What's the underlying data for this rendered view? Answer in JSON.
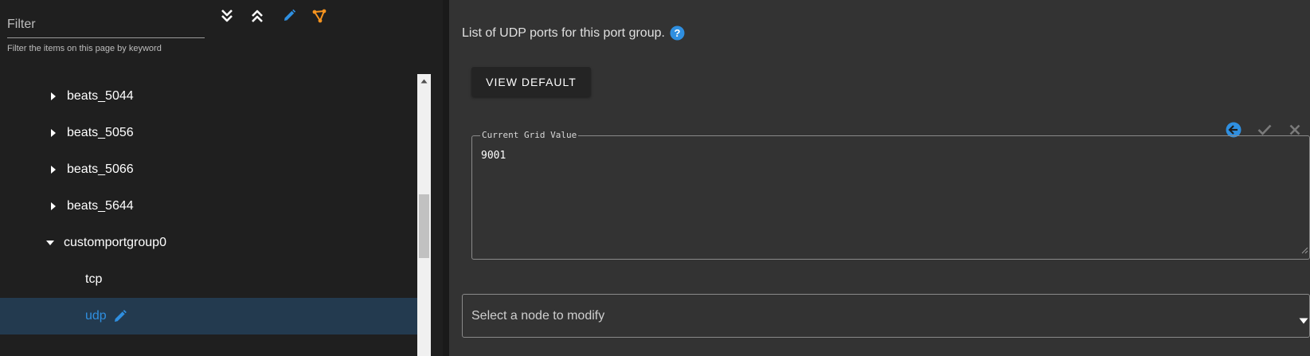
{
  "filter": {
    "label": "Filter",
    "hint": "Filter the items on this page by keyword"
  },
  "toolbar": {
    "icons": [
      "expand-all-icon",
      "collapse-all-icon",
      "edit-pencil-icon",
      "share-graph-icon"
    ]
  },
  "tree": {
    "items": [
      {
        "label": "beats_5044",
        "state": "collapsed"
      },
      {
        "label": "beats_5056",
        "state": "collapsed"
      },
      {
        "label": "beats_5066",
        "state": "collapsed"
      },
      {
        "label": "beats_5644",
        "state": "collapsed"
      },
      {
        "label": "customportgroup0",
        "state": "expanded"
      },
      {
        "label": "tcp",
        "state": "leaf"
      },
      {
        "label": "udp",
        "state": "selected"
      }
    ]
  },
  "detail": {
    "description": "List of UDP ports for this port group.",
    "view_default_label": "VIEW DEFAULT",
    "grid_legend": "Current Grid Value",
    "grid_value": "9001",
    "node_select_placeholder": "Select a node to modify"
  },
  "colors": {
    "accent_blue": "#2f8fe0",
    "accent_orange": "#f5931f",
    "selected_row_bg": "#233a4f",
    "panel_bg": "#333333",
    "sidebar_bg": "#1f1f1f"
  }
}
